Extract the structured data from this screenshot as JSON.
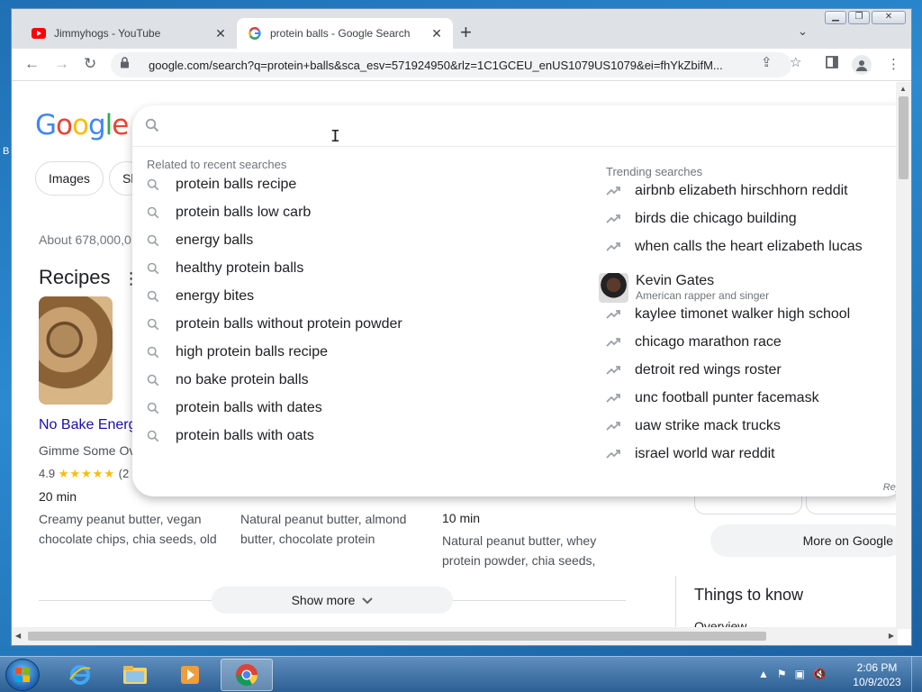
{
  "browser": {
    "tabs": [
      {
        "title": "Jimmyhogs - YouTube",
        "favicon": "youtube-icon",
        "active": false
      },
      {
        "title": "protein balls - Google Search",
        "favicon": "google-g-icon",
        "active": true
      }
    ],
    "url": "google.com/search?q=protein+balls&sca_esv=571924950&rlz=1C1GCEU_enUS1079US1079&ei=fhYkZbifM..."
  },
  "page": {
    "logo": {
      "G": "G",
      "o1": "o",
      "o2": "o",
      "g": "g",
      "l": "l",
      "e": "e"
    },
    "chips": {
      "images": "Images",
      "shopping_partial": "Sh"
    },
    "about": "About 678,000,0",
    "recipes_heading": "Recipes",
    "recipe1": {
      "title": "No Bake Energ",
      "source": "Gimme Some Ov",
      "rating": "4.9",
      "stars": "★★★★★",
      "rating_count": "(2",
      "time": "20 min",
      "ingredients": "Creamy peanut butter, vegan chocolate chips, chia seeds, old"
    },
    "recipe2": {
      "ingredients": "Natural peanut butter, almond butter, chocolate protein"
    },
    "recipe3": {
      "time": "10 min",
      "ingredients": "Natural peanut butter, whey protein powder, chia seeds,"
    },
    "show_more": "Show more",
    "more_on_google": "More on Google",
    "things_to_know": "Things to know",
    "overview": "Overview"
  },
  "dropdown": {
    "related_heading": "Related to recent searches",
    "related": [
      "protein balls recipe",
      "protein balls low carb",
      "energy balls",
      "healthy protein balls",
      "energy bites",
      "protein balls without protein powder",
      "high protein balls recipe",
      "no bake protein balls",
      "protein balls with dates",
      "protein balls with oats"
    ],
    "trending_heading": "Trending searches",
    "trending_top": [
      "airbnb elizabeth hirschhorn reddit",
      "birds die chicago building",
      "when calls the heart elizabeth lucas"
    ],
    "entity": {
      "name": "Kevin Gates",
      "description": "American rapper and singer"
    },
    "trending_bottom": [
      "kaylee timonet walker high school",
      "chicago marathon race",
      "detroit red wings roster",
      "unc football punter facemask",
      "uaw strike mack trucks",
      "israel world war reddit"
    ],
    "report": "Repo"
  },
  "taskbar": {
    "time": "2:06 PM",
    "date": "10/9/2023"
  },
  "desktop": {
    "edge_text": "B"
  },
  "colors": {
    "google_blue": "#4285f4",
    "google_red": "#ea4335",
    "google_yellow": "#fbbc05",
    "google_green": "#34a853",
    "link": "#1a0dab"
  }
}
